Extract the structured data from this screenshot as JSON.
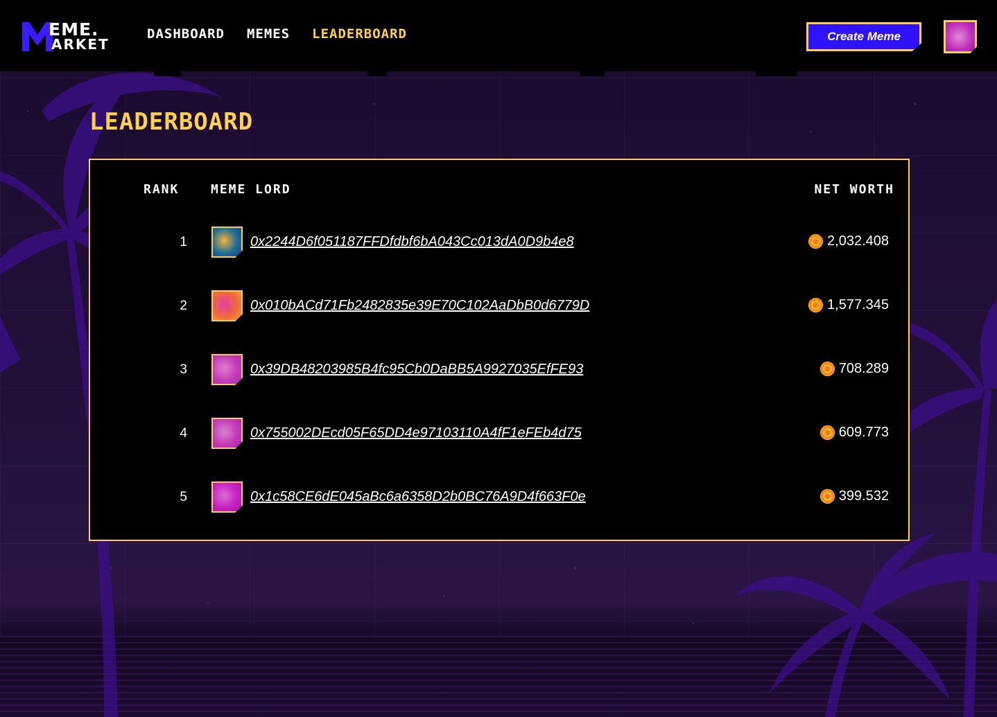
{
  "brand": {
    "logo_line1": "EME.",
    "logo_line2": "ARKET",
    "colors": {
      "accent": "#ffd14f",
      "primary": "#2f12ff",
      "bg": "#1e0e33"
    }
  },
  "nav": {
    "items": [
      {
        "label": "Dashboard",
        "active": false
      },
      {
        "label": "Memes",
        "active": false
      },
      {
        "label": "Leaderboard",
        "active": true
      }
    ]
  },
  "header": {
    "create_label": "Create Meme",
    "avatar_icon": "user-avatar-icon"
  },
  "page": {
    "title": "Leaderboard"
  },
  "table": {
    "columns": {
      "rank": "Rank",
      "lord": "Meme Lord",
      "worth": "Net Worth"
    },
    "coin_icon": "coin-icon",
    "rows": [
      {
        "rank": "1",
        "address": "0x2244D6f051187FFDfdbf6bA043Cc013dA0D9b4e8",
        "worth": "2,032.408",
        "thumb_colors": [
          "#f2b33a",
          "#1d6f95",
          "#2a3d80"
        ]
      },
      {
        "rank": "2",
        "address": "0x010bACd71Fb2482835e39E70C102AaDbB0d6779D",
        "worth": "1,577.345",
        "thumb_colors": [
          "#e63ca6",
          "#f06a3a",
          "#f4a23c"
        ]
      },
      {
        "rank": "3",
        "address": "0x39DB48203985B4fc95Cb0DaBB5A9927035EfFE93",
        "worth": "708.289",
        "thumb_colors": [
          "#e27fd0",
          "#c23db6",
          "#b02aa8"
        ]
      },
      {
        "rank": "4",
        "address": "0x755002DEcd05F65DD4e97103110A4fF1eFEb4d75",
        "worth": "609.773",
        "thumb_colors": [
          "#d984d1",
          "#c43ab8",
          "#b320a8"
        ]
      },
      {
        "rank": "5",
        "address": "0x1c58CE6dE045aBc6a6358D2b0BC76A9D4f663F0e",
        "worth": "399.532",
        "thumb_colors": [
          "#e06bd6",
          "#c622c0",
          "#ad14a9"
        ]
      }
    ]
  }
}
